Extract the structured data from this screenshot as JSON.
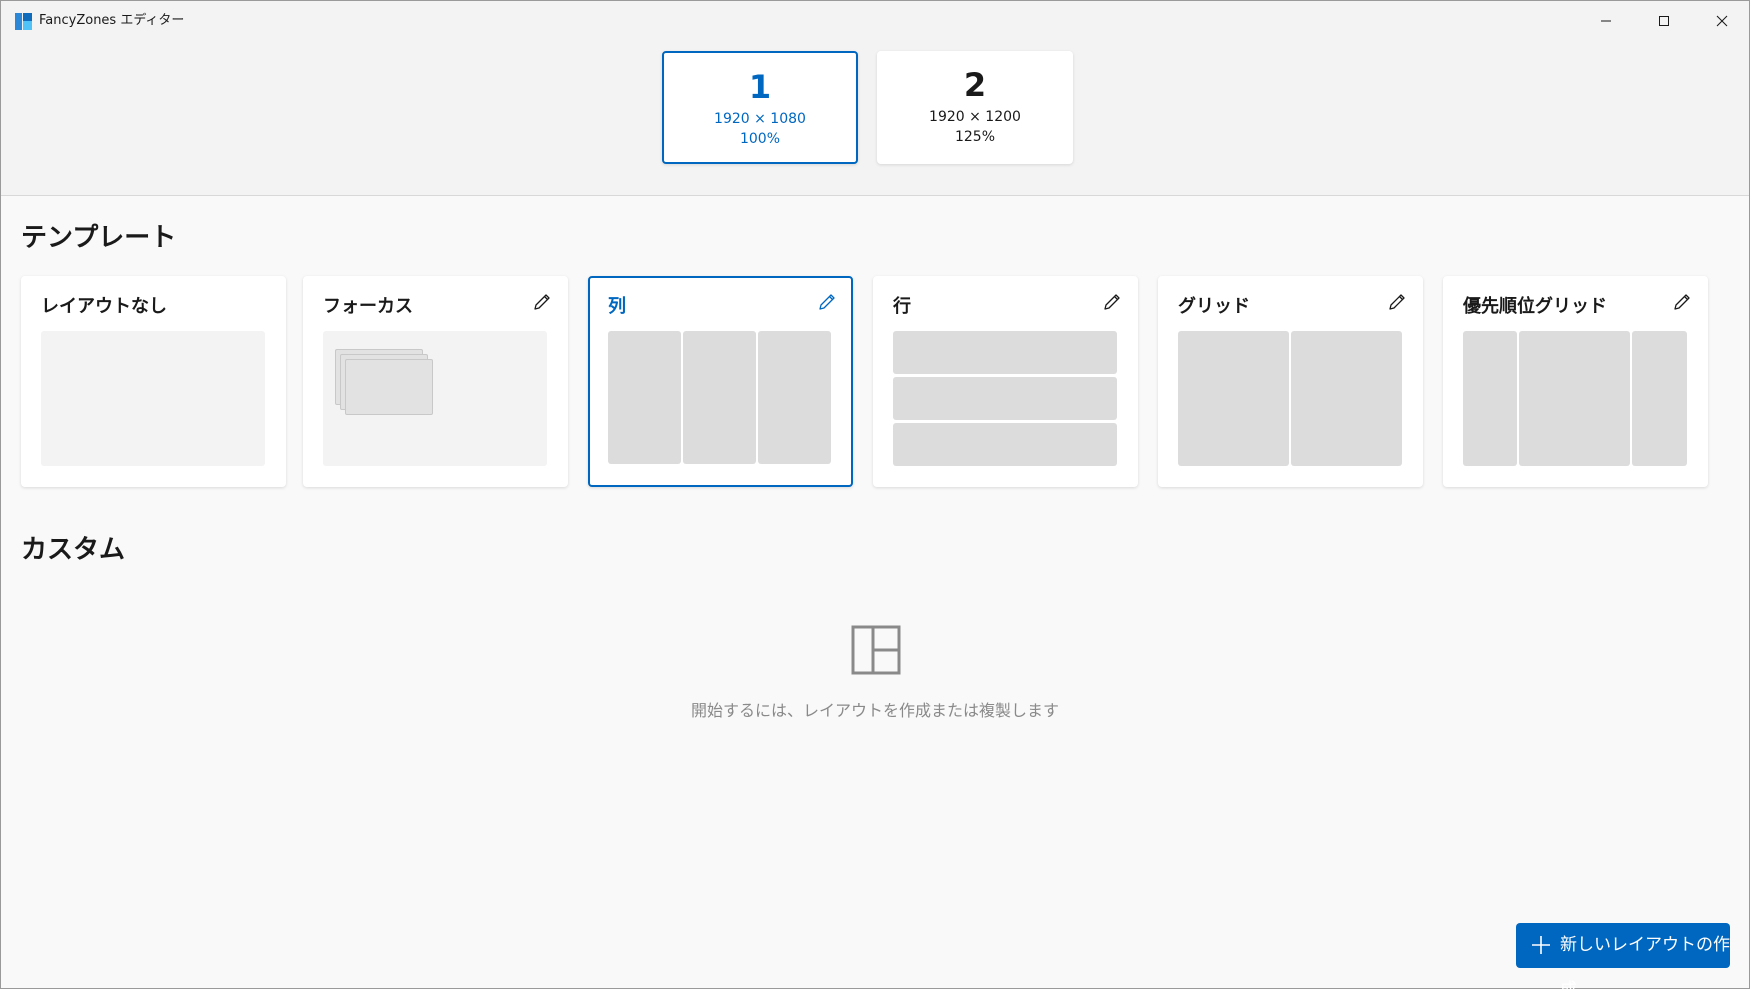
{
  "window": {
    "title": "FancyZones エディター"
  },
  "monitors": [
    {
      "number": "1",
      "resolution": "1920 × 1080",
      "scale": "100%",
      "selected": true
    },
    {
      "number": "2",
      "resolution": "1920 × 1200",
      "scale": "125%",
      "selected": false
    }
  ],
  "templates": {
    "section_title": "テンプレート",
    "cards": [
      {
        "title": "レイアウトなし",
        "editable": false,
        "selected": false
      },
      {
        "title": "フォーカス",
        "editable": true,
        "selected": false
      },
      {
        "title": "列",
        "editable": true,
        "selected": true
      },
      {
        "title": "行",
        "editable": true,
        "selected": false
      },
      {
        "title": "グリッド",
        "editable": true,
        "selected": false
      },
      {
        "title": "優先順位グリッド",
        "editable": true,
        "selected": false
      }
    ]
  },
  "custom": {
    "section_title": "カスタム",
    "empty_message": "開始するには、レイアウトを作成または複製します"
  },
  "new_layout_button": {
    "label": "新しいレイアウトの作成"
  },
  "colors": {
    "accent": "#0067c0",
    "zone": "#dcdcdc"
  }
}
